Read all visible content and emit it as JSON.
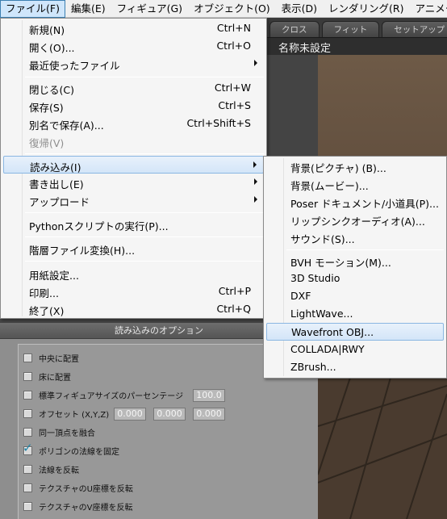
{
  "menubar": {
    "items": [
      {
        "label": "ファイル(F)"
      },
      {
        "label": "編集(E)"
      },
      {
        "label": "フィギュア(G)"
      },
      {
        "label": "オブジェクト(O)"
      },
      {
        "label": "表示(D)"
      },
      {
        "label": "レンダリング(R)"
      },
      {
        "label": "アニメーシ"
      }
    ]
  },
  "tabs": [
    "クロス",
    "フィット",
    "セットアップ"
  ],
  "document_title": "名称未設定",
  "file_menu": {
    "items": [
      {
        "label": "新規(N)",
        "accel": "Ctrl+N"
      },
      {
        "label": "開く(O)...",
        "accel": "Ctrl+O"
      },
      {
        "label": "最近使ったファイル",
        "accel": ""
      },
      {
        "label": "閉じる(C)",
        "accel": "Ctrl+W"
      },
      {
        "label": "保存(S)",
        "accel": "Ctrl+S"
      },
      {
        "label": "別名で保存(A)...",
        "accel": "Ctrl+Shift+S"
      },
      {
        "label": "復帰(V)",
        "accel": ""
      },
      {
        "label": "読み込み(I)",
        "accel": ""
      },
      {
        "label": "書き出し(E)",
        "accel": ""
      },
      {
        "label": "アップロード",
        "accel": ""
      },
      {
        "label": "Pythonスクリプトの実行(P)...",
        "accel": ""
      },
      {
        "label": "階層ファイル変換(H)...",
        "accel": ""
      },
      {
        "label": "用紙設定...",
        "accel": ""
      },
      {
        "label": "印刷...",
        "accel": "Ctrl+P"
      },
      {
        "label": "終了(X)",
        "accel": "Ctrl+Q"
      }
    ]
  },
  "import_submenu": {
    "items": [
      {
        "label": "背景(ピクチャ) (B)..."
      },
      {
        "label": "背景(ムービー)..."
      },
      {
        "label": "Poser ドキュメント/小道具(P)..."
      },
      {
        "label": "リップシンクオーディオ(A)..."
      },
      {
        "label": "サウンド(S)..."
      },
      {
        "label": "BVH モーション(M)..."
      },
      {
        "label": "3D Studio"
      },
      {
        "label": "DXF"
      },
      {
        "label": "LightWave..."
      },
      {
        "label": "Wavefront OBJ..."
      },
      {
        "label": "COLLADA|RWY"
      },
      {
        "label": "ZBrush..."
      }
    ]
  },
  "options_panel": {
    "title": "読み込みのオプション",
    "options": [
      {
        "label": "中央に配置",
        "checked": false
      },
      {
        "label": "床に配置",
        "checked": false
      },
      {
        "label": "標準フィギュアサイズのパーセンテージ",
        "checked": false
      },
      {
        "label": "オフセット (X,Y,Z)",
        "checked": false
      },
      {
        "label": "同一頂点を融合",
        "checked": false
      },
      {
        "label": "ポリゴンの法線を固定",
        "checked": true
      },
      {
        "label": "法線を反転",
        "checked": false
      },
      {
        "label": "テクスチャのU座標を反転",
        "checked": false
      },
      {
        "label": "テクスチャのV座標を反転",
        "checked": false
      }
    ],
    "percentage_value": "100.0",
    "offset_values": [
      "0.000",
      "0.000",
      "0.000"
    ]
  },
  "colors": {
    "highlight_border": "#8ab6e2",
    "checkmark": "#1e83a6",
    "menu_bg": "#f5f5f5"
  }
}
